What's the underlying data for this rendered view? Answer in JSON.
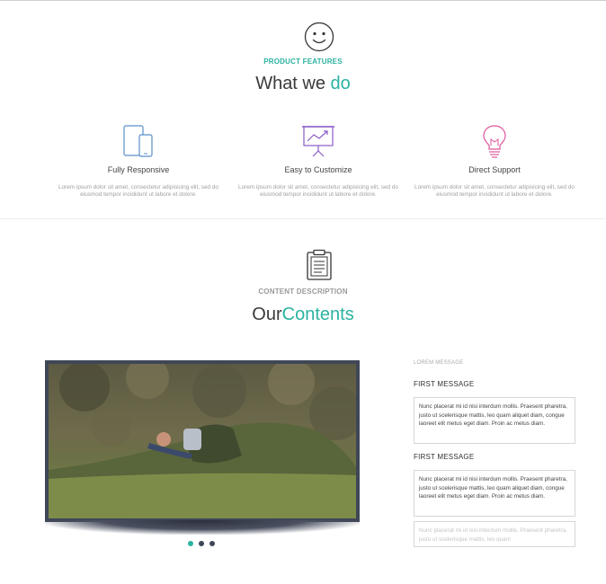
{
  "features_section": {
    "kicker": "PRODUCT FEATURES",
    "heading_plain": "What we ",
    "heading_accent": "do",
    "items": [
      {
        "icon": "devices-icon",
        "title": "Fully Responsive",
        "description": "Lorem ipsum dolor sit amet, consectetur adipisicing elit, sed do eiusmod tempor incididunt ut labore et dolore."
      },
      {
        "icon": "presentation-chart-icon",
        "title": "Easy to Customize",
        "description": "Lorem ipsum dolor sit amet, consectetur adipisicing elit, sed do eiusmod tempor incididunt ut labore et dolore."
      },
      {
        "icon": "lightbulb-icon",
        "title": "Direct Support",
        "description": "Lorem ipsum dolor sit amet, consectetur adipisicing elit, sed do eiusmod tempor incididunt ut labore et dolore."
      }
    ]
  },
  "contents_section": {
    "kicker": "CONTENT DESCRIPTION",
    "heading_plain": "Our",
    "heading_accent": "Contents",
    "slider": {
      "image": "man-lying-on-grass-photo",
      "dot_count": 3,
      "active_dot": 1
    },
    "panel": {
      "label": "LOREM MESSAGE",
      "messages": [
        {
          "title": "FIRST MESSAGE",
          "text": "Nunc placerat mi id nisi interdum mollis. Praesent pharetra, justo ut scelerisque mattis, leo quam aliquet diam, congue laoreet elit metus eget diam. Proin ac metus diam."
        },
        {
          "title": "FIRST MESSAGE",
          "text": "Nunc placerat mi id nisi interdum mollis. Praesent pharetra, justo ut scelerisque mattis, leo quam aliquet diam, congue laoreet elit metus eget diam. Proin ac metus diam."
        }
      ],
      "partial_text": "Nunc placerat mi id nisi interdum mollis. Praesent pharetra, justo ut scelerisque mattis, leo quam"
    }
  },
  "colors": {
    "accent": "#2bb3a0",
    "icon_blue": "#5b8fc9",
    "icon_purple": "#8a5cc7",
    "icon_pink": "#e0569a",
    "frame": "#3f4757"
  }
}
